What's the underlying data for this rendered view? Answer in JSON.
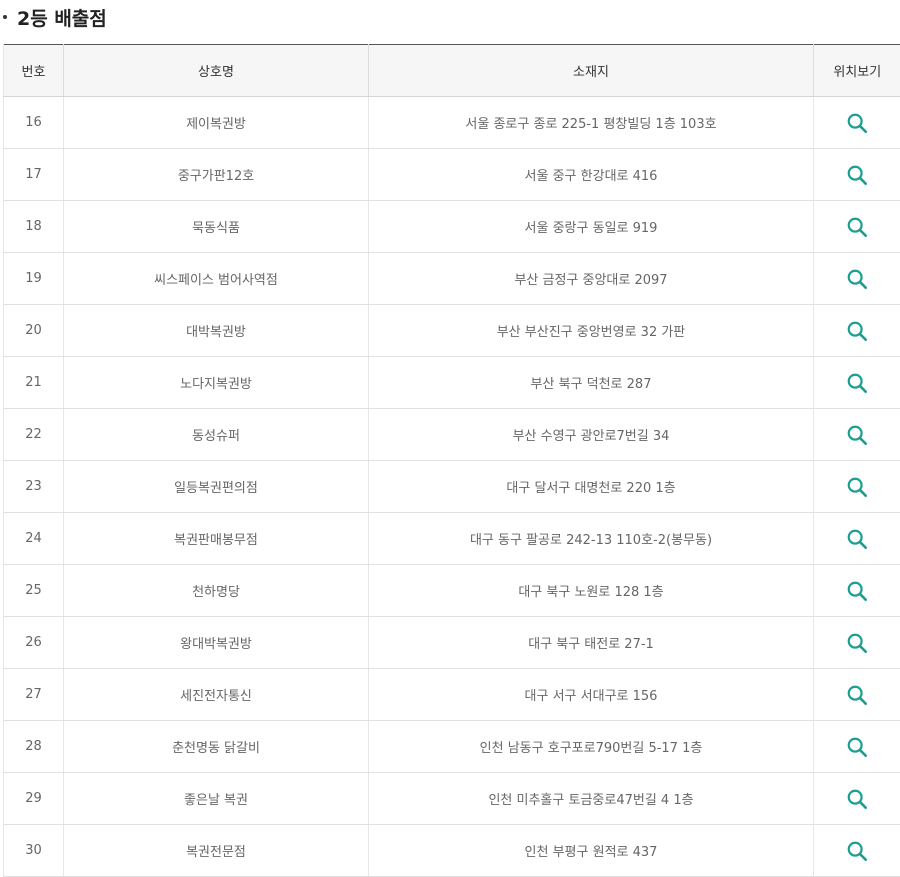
{
  "section": {
    "title": "2등 배출점"
  },
  "table": {
    "headers": {
      "no": "번호",
      "name": "상호명",
      "address": "소재지",
      "map": "위치보기"
    },
    "rows": [
      {
        "no": "16",
        "name": "제이복권방",
        "address": "서울 종로구 종로 225-1 평창빌딩 1층 103호"
      },
      {
        "no": "17",
        "name": "중구가판12호",
        "address": "서울 중구 한강대로 416"
      },
      {
        "no": "18",
        "name": "묵동식품",
        "address": "서울 중랑구 동일로 919"
      },
      {
        "no": "19",
        "name": "씨스페이스 범어사역점",
        "address": "부산 금정구 중앙대로 2097"
      },
      {
        "no": "20",
        "name": "대박복권방",
        "address": "부산 부산진구 중앙번영로 32 가판"
      },
      {
        "no": "21",
        "name": "노다지복권방",
        "address": "부산 북구 덕천로 287"
      },
      {
        "no": "22",
        "name": "동성슈퍼",
        "address": "부산 수영구 광안로7번길 34"
      },
      {
        "no": "23",
        "name": "일등복권편의점",
        "address": "대구 달서구 대명천로 220 1층"
      },
      {
        "no": "24",
        "name": "복권판매봉무점",
        "address": "대구 동구 팔공로 242-13 110호-2(봉무동)"
      },
      {
        "no": "25",
        "name": "천하명당",
        "address": "대구 북구 노원로 128 1층"
      },
      {
        "no": "26",
        "name": "왕대박복권방",
        "address": "대구 북구 태전로 27-1"
      },
      {
        "no": "27",
        "name": "세진전자통신",
        "address": "대구 서구 서대구로 156"
      },
      {
        "no": "28",
        "name": "춘천명동 닭갈비",
        "address": "인천 남동구 호구포로790번길 5-17 1층"
      },
      {
        "no": "29",
        "name": "좋은날 복권",
        "address": "인천 미추홀구 토금중로47번길 4 1층"
      },
      {
        "no": "30",
        "name": "복권전문점",
        "address": "인천 부평구 원적로 437"
      }
    ]
  },
  "icons": {
    "search": "search-icon"
  },
  "colors": {
    "accent": "#1a9e8f",
    "header_bg": "#f6f6f6",
    "text": "#666666"
  }
}
